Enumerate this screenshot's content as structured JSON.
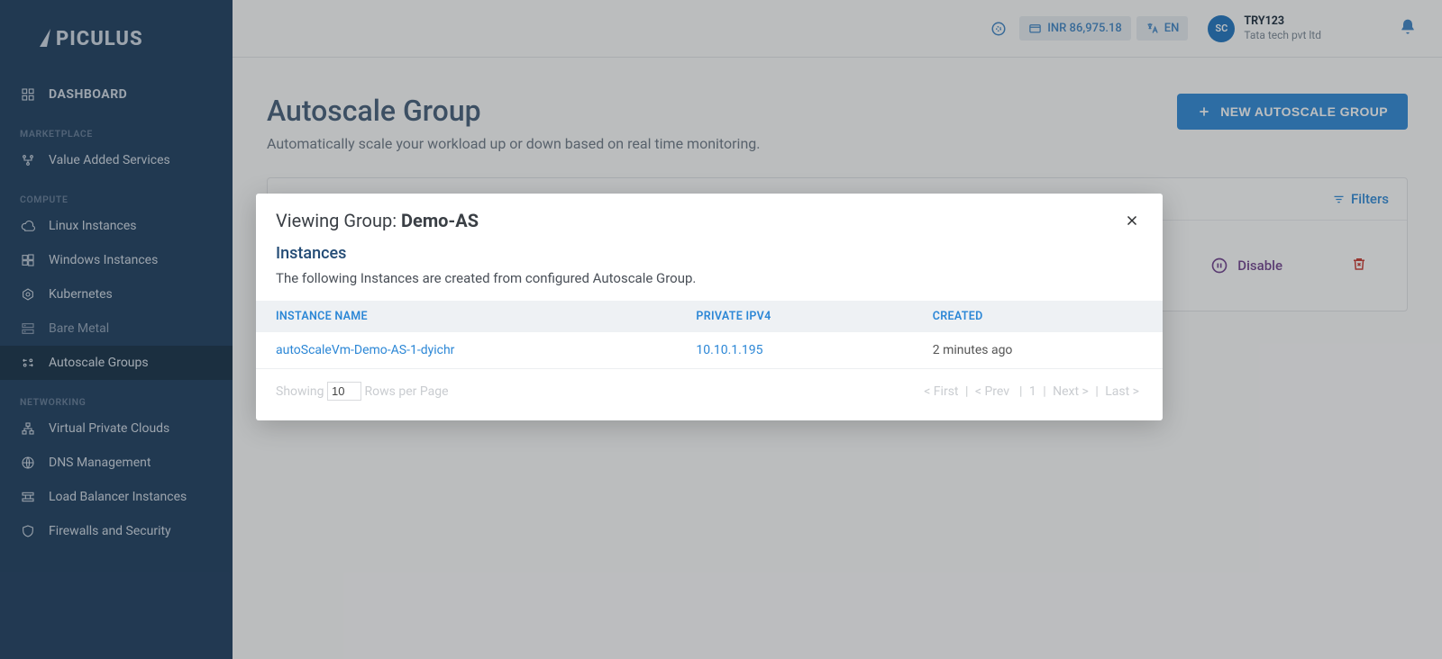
{
  "brand": "APICULUS",
  "sidebar": {
    "dashboard": "DASHBOARD",
    "sections": {
      "marketplace": "MARKETPLACE",
      "compute": "COMPUTE",
      "networking": "NETWORKING"
    },
    "items": {
      "valueAdded": "Value Added Services",
      "linux": "Linux Instances",
      "windows": "Windows Instances",
      "kubernetes": "Kubernetes",
      "bareMetal": "Bare Metal",
      "autoscale": "Autoscale Groups",
      "vpc": "Virtual Private Clouds",
      "dns": "DNS Management",
      "lb": "Load Balancer Instances",
      "firewalls": "Firewalls and Security"
    }
  },
  "topbar": {
    "balance": "INR 86,975.18",
    "lang": "EN",
    "avatarInitials": "SC",
    "userName": "TRY123",
    "company": "Tata tech pvt ltd"
  },
  "page": {
    "title": "Autoscale Group",
    "subtitle": "Automatically scale your workload up or down based on real time monitoring.",
    "newBtn": "NEW AUTOSCALE GROUP",
    "filters": "Filters",
    "disable": "Disable"
  },
  "modal": {
    "titlePrefix": "Viewing Group: ",
    "groupName": "Demo-AS",
    "sectionTitle": "Instances",
    "sectionDesc": "The following Instances are created from configured Autoscale Group.",
    "cols": {
      "name": "INSTANCE NAME",
      "ip": "PRIVATE IPV4",
      "created": "CREATED"
    },
    "instances": [
      {
        "name": "autoScaleVm-Demo-AS-1-dyichr",
        "ip": "10.10.1.195",
        "created": "2 minutes ago"
      }
    ],
    "pagination": {
      "showing": "Showing",
      "rowsLabel": "Rows per Page",
      "rowsValue": "10",
      "first": "< First",
      "prev": "< Prev",
      "page": "1",
      "next": "Next >",
      "last": "Last >"
    }
  }
}
